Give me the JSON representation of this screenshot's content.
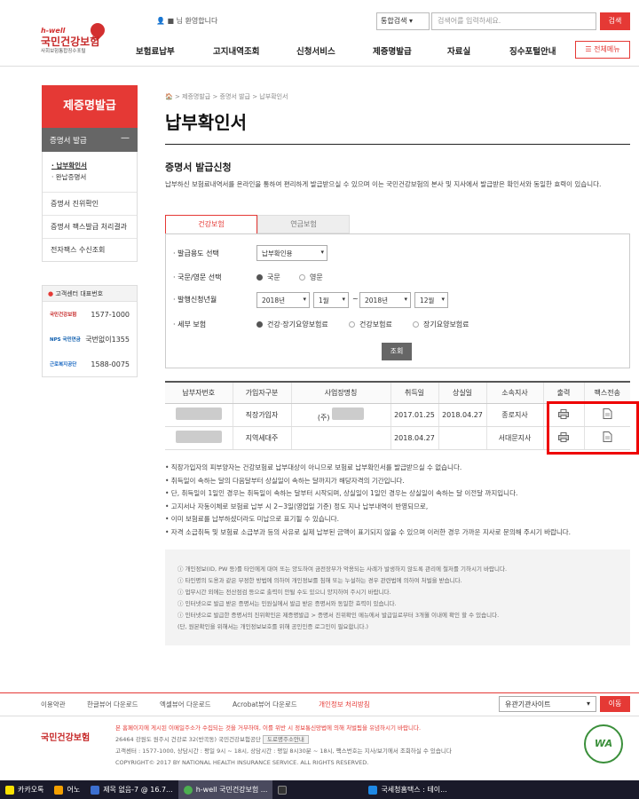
{
  "header": {
    "logo_small": "h-well",
    "logo_main": "국민건강보험",
    "logo_sub": "사회보험통합징수포털",
    "user_greeting": "■ 님 환영합니다",
    "search_scope": "통합검색",
    "search_placeholder": "검색어를 입력하세요.",
    "search_button": "검색",
    "nav": [
      "보험료납부",
      "고지내역조회",
      "신청서비스",
      "제증명발급",
      "자료실",
      "징수포털안내"
    ],
    "all_menu": "전체메뉴"
  },
  "sidebar": {
    "title": "제증명발급",
    "sub_open": "증명서 발급",
    "sub_children": [
      "· 납부확인서",
      "· 완납증명서"
    ],
    "items": [
      "증명서 진위확인",
      "증명서 팩스발급 처리결과",
      "전자팩스 수신조회"
    ],
    "cs_title": "고객센터 대표번호",
    "cs_rows": [
      {
        "org": "국민건강보험",
        "phone": "1577-1000"
      },
      {
        "org": "NPS 국민연금",
        "phone": "국번없이1355"
      },
      {
        "org": "근로복지공단",
        "phone": "1588-0075"
      }
    ]
  },
  "breadcrumb": "> 제증명발급 > 증명서 발급 > 납부확인서",
  "page_title": "납부확인서",
  "section_title": "증명서 발급신청",
  "description": "납부하신 보험료내역서를 온라인을 통하여 편리하게 발급받으실 수 있으며 이는 국민건강보험의 본사 및 지사에서 발급받은 확인서와 동일한 효력이 있습니다.",
  "tabs": {
    "active": "건강보험",
    "inactive": "연금보험"
  },
  "form": {
    "purpose_label": "발급용도 선택",
    "purpose_value": "납부확인용",
    "lang_label": "국문/영문 선택",
    "lang_options": [
      "국문",
      "영문"
    ],
    "period_label": "발행신청년월",
    "from_year": "2018년",
    "from_month": "1월",
    "tilde": "~",
    "to_year": "2018년",
    "to_month": "12월",
    "detail_label": "세부 보험",
    "detail_options": [
      "건강·장기요양보험료",
      "건강보험료",
      "장기요양보험료"
    ],
    "query_button": "조회"
  },
  "table": {
    "headers": [
      "납부자번호",
      "가입자구분",
      "사업장명칭",
      "취득일",
      "상실일",
      "소속지사",
      "출력",
      "팩스전송"
    ],
    "rows": [
      {
        "type": "직장가입자",
        "company": "(주)",
        "acquired": "2017.01.25",
        "lost": "2018.04.27",
        "branch": "종로지사"
      },
      {
        "type": "지역세대주",
        "company": "",
        "acquired": "2018.04.27",
        "lost": "",
        "branch": "서대문지사"
      }
    ]
  },
  "notes": [
    "• 직장가입자의 피부양자는 건강보험료 납부대상이 아니므로 보험료 납부확인서를 발급받으실 수 없습니다.",
    "• 취득일이 속하는 달의 다음달부터 상실일이 속하는 달까지가 해당자격의 기간입니다.",
    "• 단, 취득일이 1일인 경우는 취득일이 속하는 달부터 시작되며, 상실일이 1일인 경우는 상실일이 속하는 달 이전달 까지입니다.",
    "• 고지서나 자동이체로 보험료 납부 시 2~3일(영업일 기준) 정도 지나 납부내역이 반영되므로,",
    "• 이미 보험료를 납부하셨더라도 미납으로 표기될 수 있습니다.",
    "• 자격 소급취득 및 보험료 소급부과 등의 사유로 실제 납부된 금액이 표기되지 않을 수 있으며 이러한 경우 가까운 지사로 문의해 주시기 바랍니다."
  ],
  "guide": [
    "ⓘ 개인정보(ID, PW 등)를 타인에게 대여 또는 양도하여 금전장부가 악용되는 사례가 발생하지 않도록 관리에 철저를 기하시기 바랍니다.",
    "ⓘ 타인명의 도용과 같은 부정한 방법에 의하여 개인정보를 침해 또는 누설하는 경우 관련법에 의하여 처벌을 받습니다.",
    "ⓘ 업무시간 외에는 전산점검 등으로 출력이 안될 수도 있으니 양지하여 주시기 바랍니다.",
    "ⓘ 인터넷으로 발급 받은 증명서는 민원실에서 발급 받은 증명서와 동일한 효력이 있습니다.",
    "ⓘ 인터넷으로 발급한 증명서의 진위확인은 제증명발급 > 증명서 진위확인 메뉴에서 발급일로부터 3개월 이내에 확인 할 수 있습니다.",
    "   (단, 원본확인을 위해서는 개인정보보호를 위해 공인인증 로그인이 필요합니다.)"
  ],
  "footer": {
    "links": [
      "이용약관",
      "한글뷰어 다운로드",
      "엑셀뷰어 다운로드",
      "Acrobat뷰어 다운로드",
      "개인정보 처리방침"
    ],
    "related_sites": "유관기관사이트",
    "go_button": "이동",
    "logo": "국민건강보험",
    "notice": "본 홈페이지에 게시된 이메일주소가 수집되는 것을 거부하며, 이를 위반 시 정보통신망법에 의해 처벌됨을 유념하시기 바랍니다.",
    "address": "26464 강원도 원주시 건강로 32(반곡동) 국민건강보험공단",
    "address_btn": "도로명주소안내",
    "contact": "고객센터 : 1577-1000, 상담시간 : 평일 9시 ~ 18시, 상담시간 : 평일 8시30분 ~ 18시, 팩스번호는 지사/보기에서 조회하실 수 있습니다",
    "copyright": "COPYRIGHT© 2017 BY NATIONAL HEALTH INSURANCE SERVICE. ALL RIGHTS RESERVED.",
    "wa_mark": "WA"
  },
  "taskbar": [
    {
      "label": "카카오톡",
      "color": "#f9e000"
    },
    {
      "label": "어노",
      "color": "#f4a000"
    },
    {
      "label": "제목 없음-7 @ 16.7...",
      "color": "#3c6fd0"
    },
    {
      "label": "h-well 국민건강보험 ...",
      "color": "#4caf50",
      "active": true
    },
    {
      "label": "",
      "color": "#333"
    },
    {
      "label": "국세청홈택스 : 테이...",
      "color": "#1e88e5"
    }
  ]
}
